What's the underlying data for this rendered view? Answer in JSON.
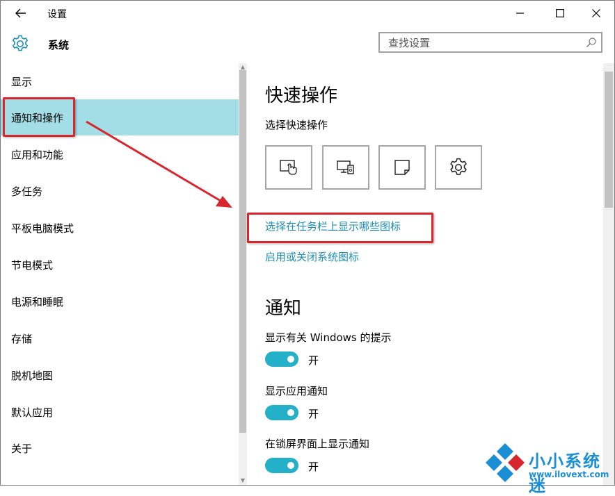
{
  "window": {
    "title": "设置",
    "section_title": "系统"
  },
  "search": {
    "placeholder": "查找设置"
  },
  "sidebar": {
    "items": [
      {
        "label": "显示"
      },
      {
        "label": "通知和操作"
      },
      {
        "label": "应用和功能"
      },
      {
        "label": "多任务"
      },
      {
        "label": "平板电脑模式"
      },
      {
        "label": "节电模式"
      },
      {
        "label": "电源和睡眠"
      },
      {
        "label": "存储"
      },
      {
        "label": "脱机地图"
      },
      {
        "label": "默认应用"
      },
      {
        "label": "关于"
      }
    ],
    "selected_index": 1
  },
  "main": {
    "quick_actions_heading": "快速操作",
    "quick_actions_subheading": "选择快速操作",
    "quick_action_tiles": [
      {
        "icon": "tablet-mode-icon"
      },
      {
        "icon": "connect-icon"
      },
      {
        "icon": "note-icon"
      },
      {
        "icon": "settings-icon"
      }
    ],
    "link_taskbar_icons": "选择在任务栏上显示哪些图标",
    "link_system_icons": "启用或关闭系统图标",
    "notifications_heading": "通知",
    "toggles": [
      {
        "label": "显示有关 Windows 的提示",
        "state": "开"
      },
      {
        "label": "显示应用通知",
        "state": "开"
      },
      {
        "label": "在锁屏界面上显示通知",
        "state": "开"
      }
    ]
  },
  "colors": {
    "selected_item": "#a3dde6",
    "accent_link": "#1e8fb6",
    "toggle_on": "#25b0c9",
    "annotation_red": "#d8262f"
  },
  "watermark": {
    "title": "小小系统迷",
    "url": "www.ilovext.com"
  }
}
